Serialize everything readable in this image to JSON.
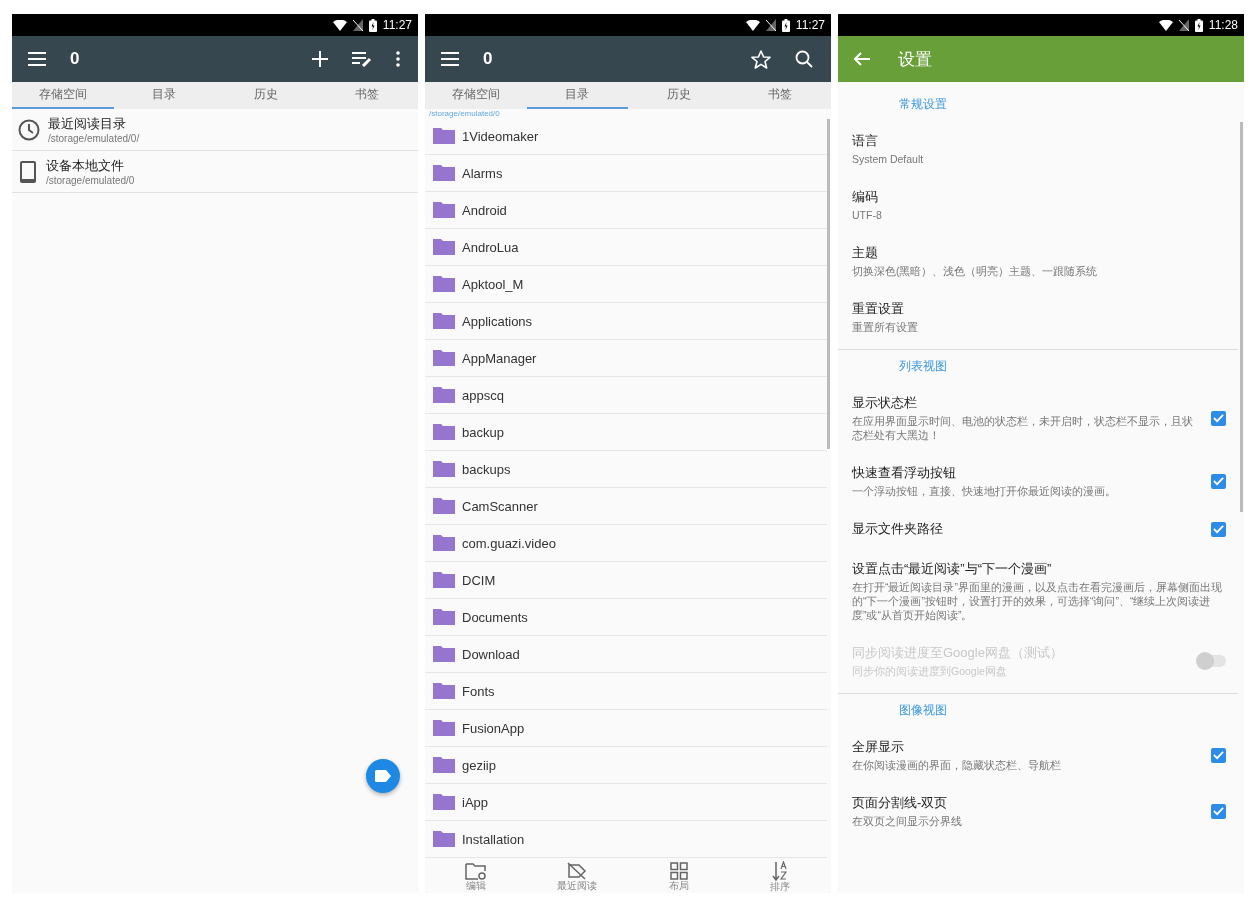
{
  "storage_screen": {
    "status_time": "11:27",
    "title": "0",
    "tabs": [
      {
        "label": "存储空间",
        "selected": true
      },
      {
        "label": "目录",
        "selected": false
      },
      {
        "label": "历史",
        "selected": false
      },
      {
        "label": "书签",
        "selected": false
      }
    ],
    "items": [
      {
        "title": "最近阅读目录",
        "path": "/storage/emulated/0/"
      },
      {
        "title": "设备本地文件",
        "path": "/storage/emulated/0"
      }
    ]
  },
  "folder_screen": {
    "status_time": "11:27",
    "title": "0",
    "tabs": [
      {
        "label": "存储空间",
        "selected": false
      },
      {
        "label": "目录",
        "selected": true
      },
      {
        "label": "历史",
        "selected": false
      },
      {
        "label": "书签",
        "selected": false
      }
    ],
    "path": "/storage/emulated/0",
    "folders": [
      "1Videomaker",
      "Alarms",
      "Android",
      "AndroLua",
      "Apktool_M",
      "Applications",
      "AppManager",
      "appscq",
      "backup",
      "backups",
      "CamScanner",
      "com.guazi.video",
      "DCIM",
      "Documents",
      "Download",
      "Fonts",
      "FusionApp",
      "geziip",
      "iApp",
      "Installation"
    ],
    "bottom_nav": [
      "编辑",
      "最近阅读",
      "布局",
      "排序"
    ]
  },
  "settings_screen": {
    "status_time": "11:28",
    "title": "设置",
    "sections": [
      {
        "header": "常规设置",
        "items": [
          {
            "kind": "text",
            "title": "语言",
            "summary": "System Default",
            "disabled": false
          },
          {
            "kind": "text",
            "title": "编码",
            "summary": "UTF-8",
            "disabled": false
          },
          {
            "kind": "text",
            "title": "主题",
            "summary": "切换深色(黑暗）、浅色（明亮）主题、一跟随系统",
            "disabled": false
          },
          {
            "kind": "text",
            "title": "重置设置",
            "summary": "重置所有设置",
            "disabled": false
          }
        ]
      },
      {
        "header": "列表视图",
        "items": [
          {
            "kind": "checkbox",
            "title": "显示状态栏",
            "summary": "在应用界面显示时间、电池的状态栏，未开启时，状态栏不显示，且状态栏处有大黑边！",
            "checked": true,
            "disabled": false
          },
          {
            "kind": "checkbox",
            "title": "快速查看浮动按钮",
            "summary": "一个浮动按钮，直接、快速地打开你最近阅读的漫画。",
            "checked": true,
            "disabled": false
          },
          {
            "kind": "checkbox",
            "title": "显示文件夹路径",
            "checked": true,
            "disabled": false
          },
          {
            "kind": "text",
            "title": "设置点击“最近阅读”与“下一个漫画”",
            "summary": "在打开“最近阅读目录”界面里的漫画，以及点击在看完漫画后，屏幕侧面出现的“下一个漫画”按钮时，设置打开的效果，可选择“询问”、“继续上次阅读进度”或“从首页开始阅读”。",
            "disabled": false
          },
          {
            "kind": "switch",
            "title": "同步阅读进度至Google网盘（测试）",
            "summary": "同步你的阅读进度到Google网盘",
            "on": false,
            "disabled": true
          }
        ]
      },
      {
        "header": "图像视图",
        "items": [
          {
            "kind": "checkbox",
            "title": "全屏显示",
            "summary": "在你阅读漫画的界面，隐藏状态栏、导航栏",
            "checked": true,
            "disabled": false
          },
          {
            "kind": "checkbox",
            "title": "页面分割线-双页",
            "summary": "在双页之间显示分界线",
            "checked": true,
            "disabled": false
          }
        ]
      }
    ]
  }
}
